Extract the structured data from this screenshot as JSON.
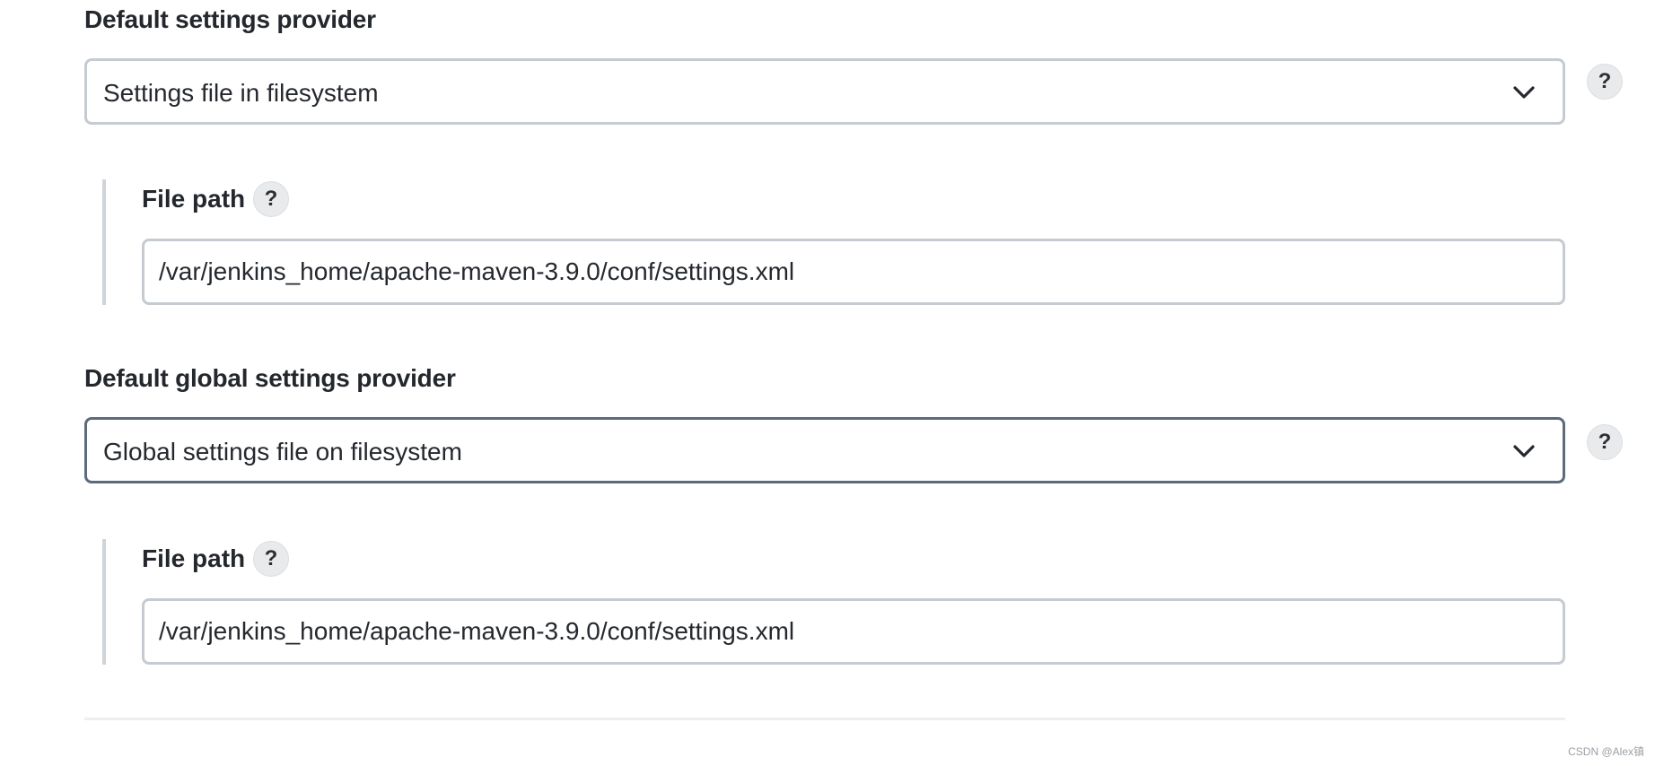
{
  "settings_provider": {
    "label": "Default settings provider",
    "selected": "Settings file in filesystem",
    "help": "?",
    "file_path": {
      "label": "File path",
      "help": "?",
      "value": "/var/jenkins_home/apache-maven-3.9.0/conf/settings.xml"
    }
  },
  "global_settings_provider": {
    "label": "Default global settings provider",
    "selected": "Global settings file on filesystem",
    "help": "?",
    "file_path": {
      "label": "File path",
      "help": "?",
      "value": "/var/jenkins_home/apache-maven-3.9.0/conf/settings.xml"
    }
  },
  "watermark": "CSDN @Alex镇",
  "icons": {
    "dropdown": "chevron-down-icon",
    "help": "help-icon"
  },
  "colors": {
    "border": "#c5cbd1",
    "focused_border": "#5b6b7b",
    "help_bg": "#e9eaec"
  }
}
